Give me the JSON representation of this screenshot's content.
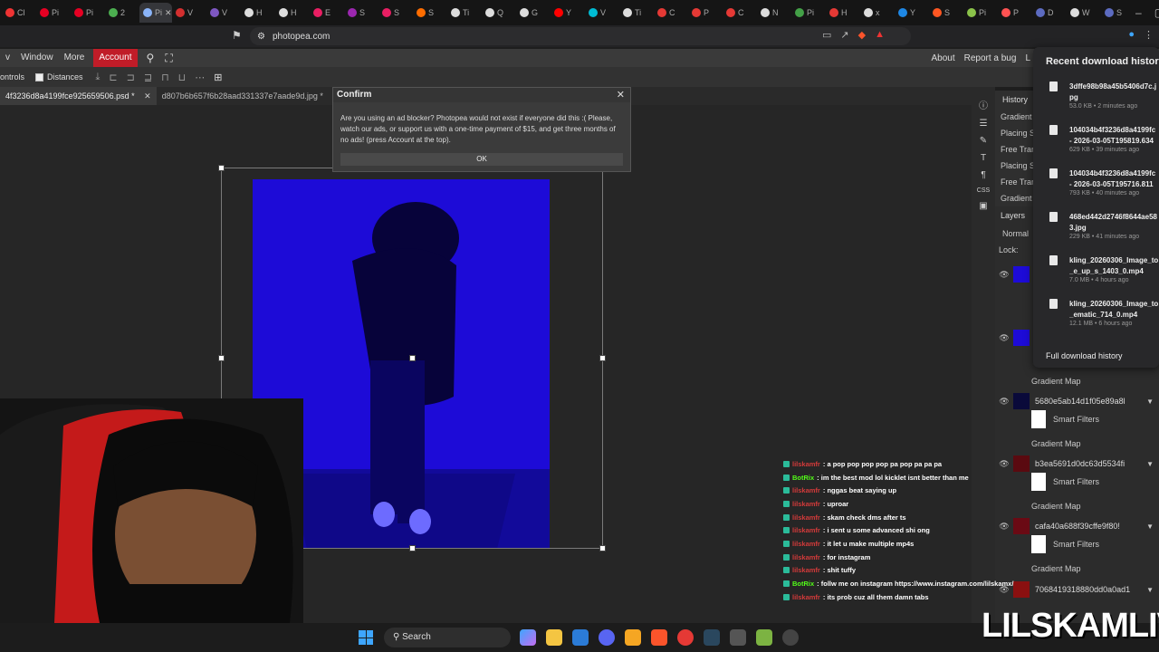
{
  "browser": {
    "tabs": [
      {
        "label": "Cl",
        "color": "#e33"
      },
      {
        "label": "Pi",
        "color": "#e60023"
      },
      {
        "label": "Pi",
        "color": "#e60023"
      },
      {
        "label": "2",
        "color": "#4caf50"
      },
      {
        "label": "Pi",
        "color": "#8ab4f8",
        "active": true
      },
      {
        "label": "V",
        "color": "#d32f2f"
      },
      {
        "label": "V",
        "color": "#7e57c2"
      },
      {
        "label": "H",
        "color": "#ddd"
      },
      {
        "label": "H",
        "color": "#ddd"
      },
      {
        "label": "E",
        "color": "#e91e63"
      },
      {
        "label": "S",
        "color": "#9c27b0"
      },
      {
        "label": "S",
        "color": "#e91e63"
      },
      {
        "label": "S",
        "color": "#ff6d00"
      },
      {
        "label": "Ti",
        "color": "#ddd"
      },
      {
        "label": "Q",
        "color": "#ddd"
      },
      {
        "label": "G",
        "color": "#ddd"
      },
      {
        "label": "Y",
        "color": "#f00"
      },
      {
        "label": "V",
        "color": "#00bcd4"
      },
      {
        "label": "Ti",
        "color": "#ddd"
      },
      {
        "label": "C",
        "color": "#e53935"
      },
      {
        "label": "P",
        "color": "#e53935"
      },
      {
        "label": "C",
        "color": "#e53935"
      },
      {
        "label": "N",
        "color": "#ddd"
      },
      {
        "label": "Pi",
        "color": "#43a047"
      },
      {
        "label": "H",
        "color": "#e53935"
      },
      {
        "label": "x",
        "color": "#ddd"
      },
      {
        "label": "Y",
        "color": "#1e88e5"
      },
      {
        "label": "S",
        "color": "#ff5722"
      },
      {
        "label": "Pi",
        "color": "#8bc34a"
      },
      {
        "label": "P",
        "color": "#ff5252"
      },
      {
        "label": "D",
        "color": "#5c6bc0"
      },
      {
        "label": "W",
        "color": "#ddd"
      },
      {
        "label": "S",
        "color": "#5c6bc0"
      }
    ],
    "url": "photopea.com"
  },
  "menu": {
    "items": [
      "Window",
      "More"
    ],
    "account": "Account",
    "right": [
      "About",
      "Report a bug",
      "L"
    ]
  },
  "options": {
    "controls": "ontrols",
    "distances": "Distances"
  },
  "doc_tabs": [
    {
      "label": "4f3236d8a4199fce925659506.psd *",
      "active": true
    },
    {
      "label": "d807b6b657f6b28aad331337e7aade9d.jpg *",
      "active": false
    }
  ],
  "dialog": {
    "title": "Confirm",
    "message": "Are you using an ad blocker? Photopea would not exist if everyone did this :( Please, watch our ads, or support us with a one-time payment of $15, and get three months of no ads! (press Account at the top).",
    "ok": "OK"
  },
  "history": {
    "title": "History",
    "items": [
      "Gradient",
      "Placing S",
      "Free Tran",
      "Placing S",
      "Free Tran",
      "Gradient"
    ]
  },
  "layers": {
    "title": "Layers",
    "blend_mode": "Normal",
    "lock_label": "Lock:",
    "groups": [
      {
        "name": "5680e5ab14d1f05e89a8l",
        "smart": "Smart Filters",
        "map": "Gradient Map"
      },
      {
        "name": "b3ea5691d0dc63d5534fi",
        "smart": "Smart Filters",
        "map": "Gradient Map"
      },
      {
        "name": "cafa40a688f39cffe9f80!",
        "smart": "Smart Filters",
        "map": "Gradient Map"
      }
    ],
    "top_map": "Gradient Map",
    "last_layer": "7068419318880dd0a0ad1"
  },
  "downloads": {
    "title": "Recent download history",
    "items": [
      {
        "name": "3dffe98b98a45b5406d7c.jpg",
        "meta": "53.0 KB • 2 minutes ago"
      },
      {
        "name": "104034b4f3236d8a4199fc - 2026-03-05T195819.634",
        "meta": "629 KB • 39 minutes ago"
      },
      {
        "name": "104034b4f3236d8a4199fc - 2026-03-05T195716.811",
        "meta": "793 KB • 40 minutes ago"
      },
      {
        "name": "468ed442d2746f8644ae583.jpg",
        "meta": "229 KB • 41 minutes ago"
      },
      {
        "name": "kling_20260306_Image_to_e_up_s_1403_0.mp4",
        "meta": "7.0 MB • 4 hours ago"
      },
      {
        "name": "kling_20260306_Image_to_ematic_714_0.mp4",
        "meta": "12.1 MB • 6 hours ago"
      }
    ],
    "full": "Full download history"
  },
  "chat": [
    {
      "user": "lilskamfr",
      "mod": false,
      "msg": ": a pop pop pop pop pa pop pa pa pa"
    },
    {
      "user": "BotRix",
      "mod": true,
      "msg": ": im the best mod lol kicklet isnt better than me"
    },
    {
      "user": "lilskamfr",
      "mod": false,
      "msg": ": nggas beat saying up"
    },
    {
      "user": "lilskamfr",
      "mod": false,
      "msg": ": uproar"
    },
    {
      "user": "lilskamfr",
      "mod": false,
      "msg": ": skam check dms after ts"
    },
    {
      "user": "lilskamfr",
      "mod": false,
      "msg": ": i sent u some advanced shi ong"
    },
    {
      "user": "lilskamfr",
      "mod": false,
      "msg": ": it let u make multiple mp4s"
    },
    {
      "user": "lilskamfr",
      "mod": false,
      "msg": ": for instagram"
    },
    {
      "user": "lilskamfr",
      "mod": false,
      "msg": ": shit tuffy"
    },
    {
      "user": "BotRix",
      "mod": true,
      "msg": ": follw me on instagram https://www.instagram.com/lilskamx/"
    },
    {
      "user": "lilskamfr",
      "mod": false,
      "msg": ": its prob cuz all them damn tabs"
    }
  ],
  "taskbar": {
    "search": "Search"
  },
  "watermark": "LILSKAMLIVE"
}
